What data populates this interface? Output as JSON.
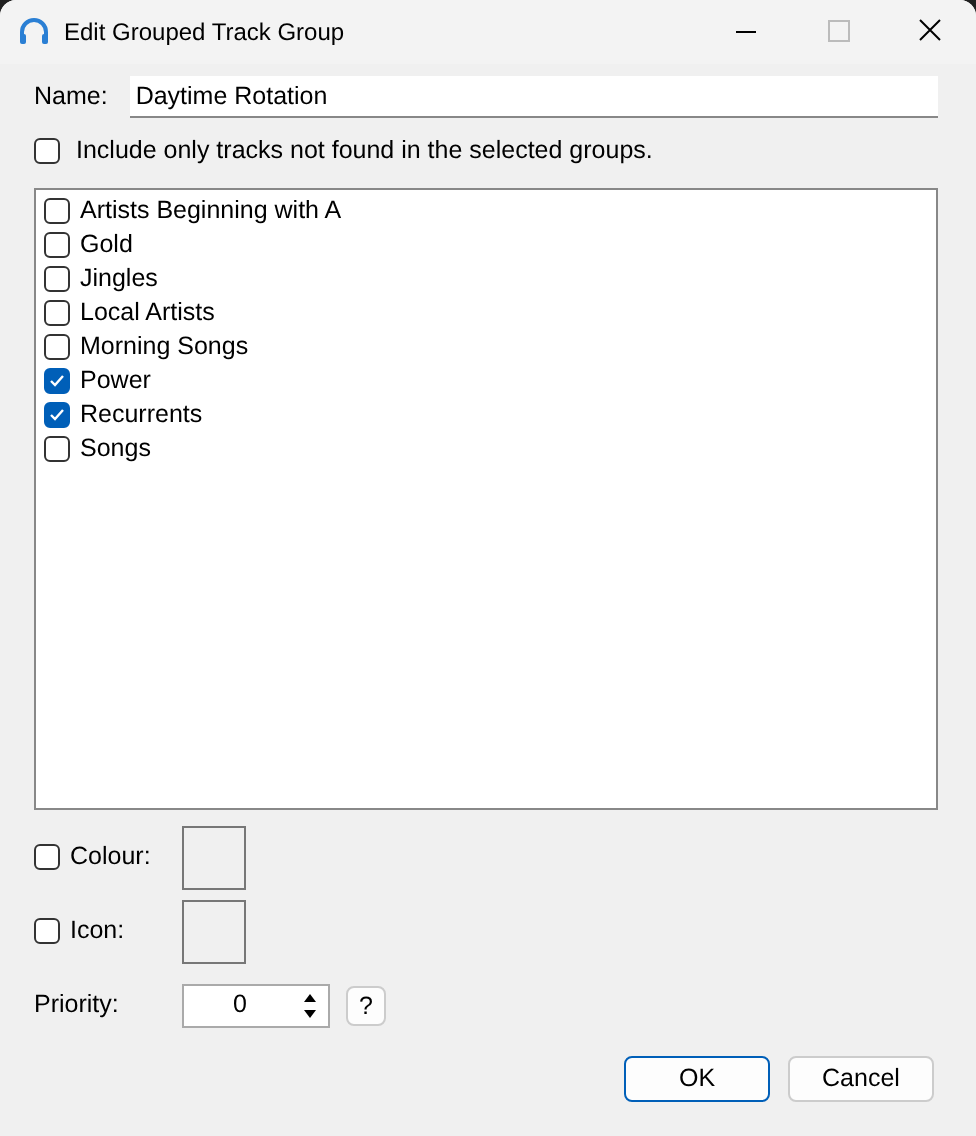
{
  "window": {
    "title": "Edit Grouped Track Group"
  },
  "name_field": {
    "label": "Name:",
    "value": "Daytime Rotation"
  },
  "exclude_option": {
    "label": "Include only tracks not found in the selected groups.",
    "checked": false
  },
  "groups": [
    {
      "label": "Artists Beginning with A",
      "checked": false
    },
    {
      "label": "Gold",
      "checked": false
    },
    {
      "label": "Jingles",
      "checked": false
    },
    {
      "label": "Local Artists",
      "checked": false
    },
    {
      "label": "Morning Songs",
      "checked": false
    },
    {
      "label": "Power",
      "checked": true
    },
    {
      "label": "Recurrents",
      "checked": true
    },
    {
      "label": "Songs",
      "checked": false
    }
  ],
  "colour": {
    "label": "Colour:",
    "checked": false
  },
  "icon": {
    "label": "Icon:",
    "checked": false
  },
  "priority": {
    "label": "Priority:",
    "value": "0"
  },
  "help_button": {
    "label": "?"
  },
  "buttons": [
    {
      "label": "OK",
      "default": true
    },
    {
      "label": "Cancel",
      "default": false
    }
  ]
}
